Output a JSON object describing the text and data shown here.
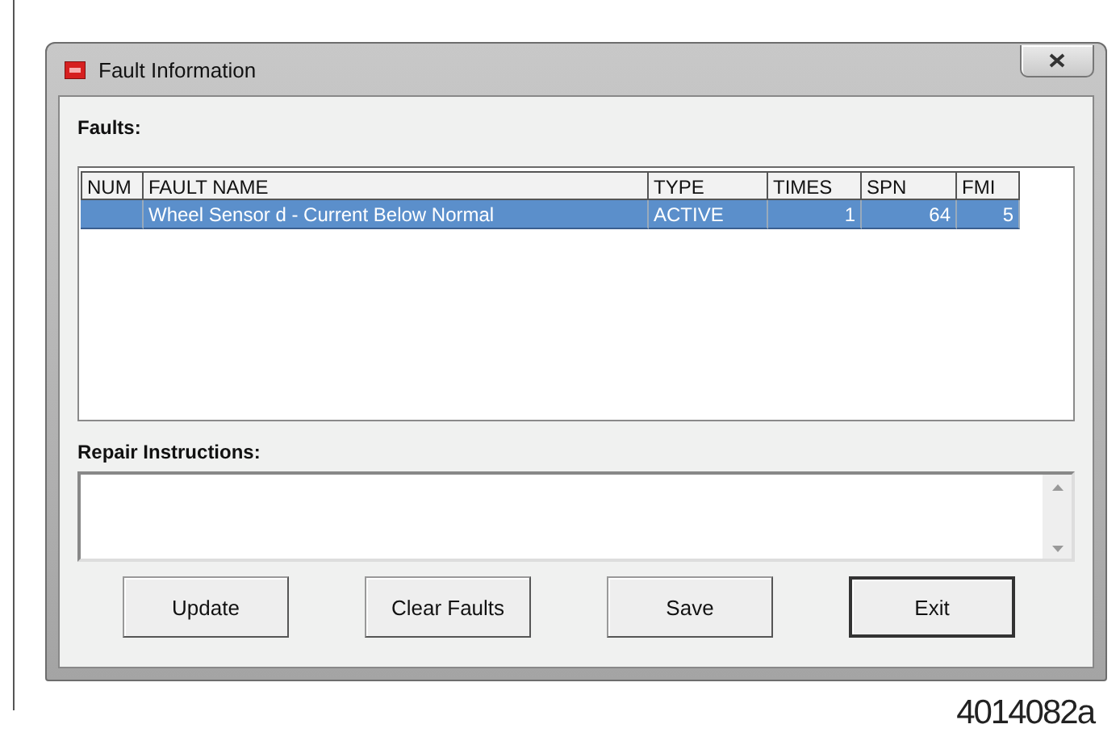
{
  "window": {
    "title": "Fault Information"
  },
  "faults": {
    "label": "Faults:",
    "columns": [
      "NUM",
      "FAULT NAME",
      "TYPE",
      "TIMES",
      "SPN",
      "FMI"
    ],
    "rows": [
      {
        "cells": [
          "",
          "Wheel Sensor d - Current Below Normal",
          "ACTIVE",
          "1",
          "64",
          "5"
        ],
        "selected": true
      }
    ]
  },
  "repair": {
    "label": "Repair Instructions:"
  },
  "buttons": [
    {
      "label": "Update",
      "default": false
    },
    {
      "label": "Clear Faults",
      "default": false
    },
    {
      "label": "Save",
      "default": false
    },
    {
      "label": "Exit",
      "default": true
    }
  ],
  "figure_id": "4014082a"
}
